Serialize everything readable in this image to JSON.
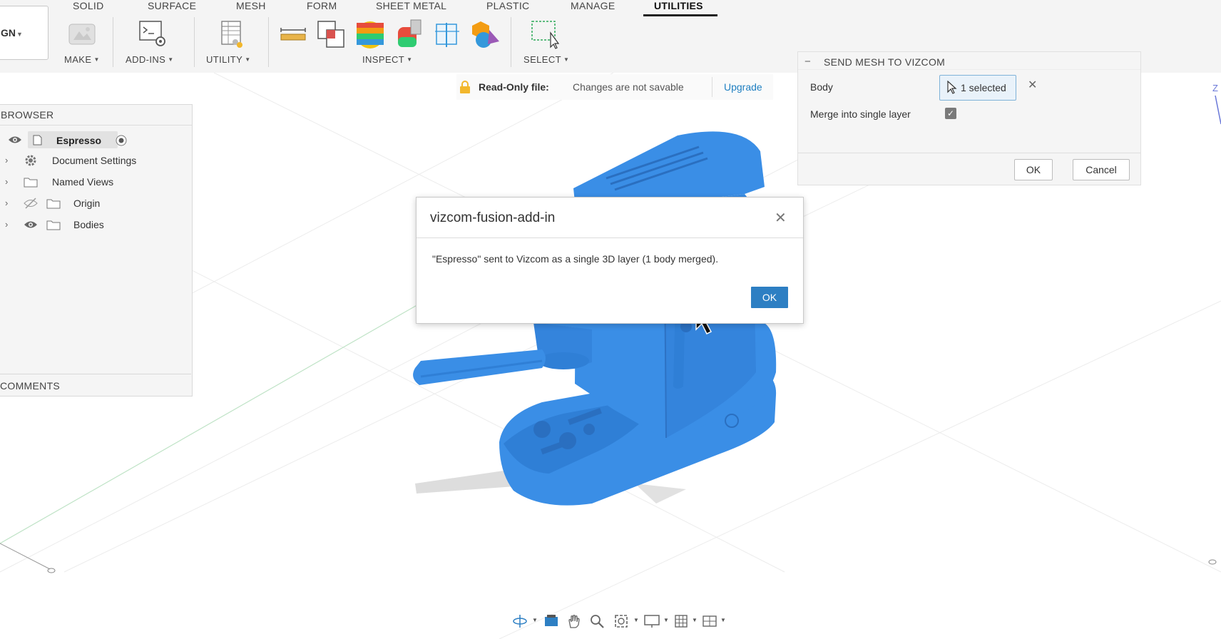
{
  "toolbar": {
    "tabs": [
      "SOLID",
      "SURFACE",
      "MESH",
      "FORM",
      "SHEET METAL",
      "PLASTIC",
      "MANAGE",
      "UTILITIES"
    ],
    "active_tab": "UTILITIES",
    "workspace_label": "GN",
    "groups": {
      "make": "MAKE",
      "add_ins": "ADD-INS",
      "utility": "UTILITY",
      "inspect": "INSPECT",
      "select": "SELECT"
    }
  },
  "banner": {
    "label": "Read-Only file:",
    "text": "Changes are not savable",
    "link": "Upgrade"
  },
  "browser": {
    "header": "BROWSER",
    "root": "Espresso",
    "items": [
      {
        "label": "Document Settings",
        "icon": "gear-icon"
      },
      {
        "label": "Named Views",
        "icon": "folder-icon"
      },
      {
        "label": "Origin",
        "icon": "folder-icon"
      },
      {
        "label": "Bodies",
        "icon": "folder-icon"
      }
    ],
    "comments": "COMMENTS"
  },
  "mesh_panel": {
    "title": "SEND MESH TO VIZCOM",
    "body_label": "Body",
    "selected_text": "1 selected",
    "merge_label": "Merge into single layer",
    "merge_checked": true,
    "ok": "OK",
    "cancel": "Cancel"
  },
  "dialog": {
    "title": "vizcom-fusion-add-in",
    "message": "\"Espresso\" sent to Vizcom as a single 3D layer (1 body merged).",
    "ok": "OK"
  },
  "viewcube": {
    "axis": "Z"
  },
  "colors": {
    "model_blue": "#3a8ee6",
    "accent_blue": "#2d7fc3",
    "link_blue": "#1f7fc1",
    "warning": "#f2b72c"
  }
}
